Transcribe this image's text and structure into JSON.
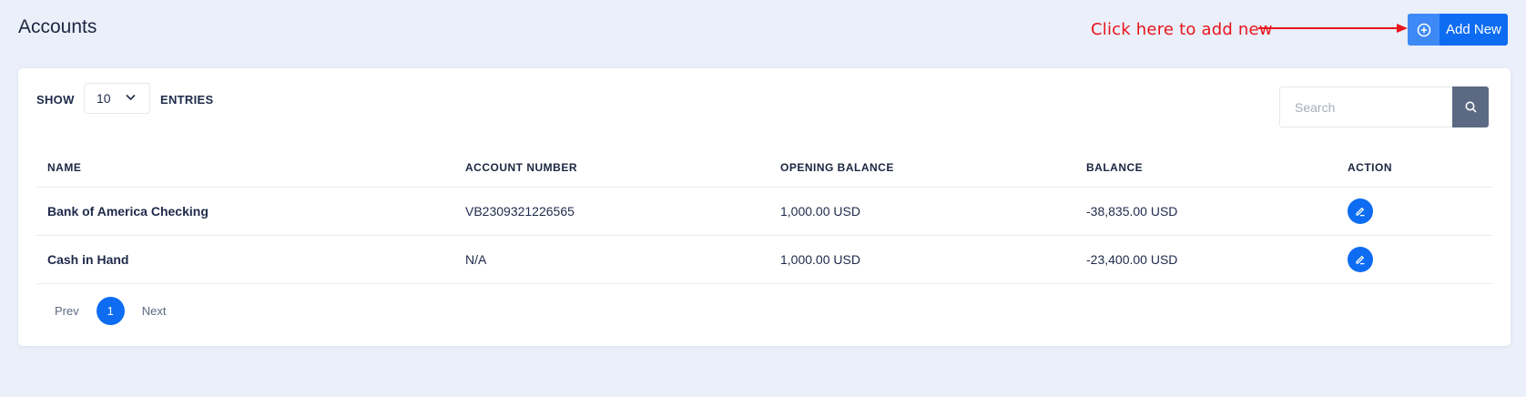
{
  "page": {
    "title": "Accounts"
  },
  "annotation": {
    "text": "Click here to add new",
    "color": "#e8141c"
  },
  "header": {
    "add_label": "Add New",
    "add_icon": "plus-circle-icon"
  },
  "controls": {
    "show_label": "SHOW",
    "entries_value": "10",
    "entries_label": "ENTRIES",
    "search_placeholder": "Search",
    "search_icon": "search-icon"
  },
  "table": {
    "columns": [
      "NAME",
      "ACCOUNT NUMBER",
      "OPENING BALANCE",
      "BALANCE",
      "ACTION"
    ],
    "rows": [
      {
        "name": "Bank of America Checking",
        "account_number": "VB2309321226565",
        "opening_balance": "1,000.00 USD",
        "balance": "-38,835.00 USD",
        "action_icon": "edit-icon"
      },
      {
        "name": "Cash in Hand",
        "account_number": "N/A",
        "opening_balance": "1,000.00 USD",
        "balance": "-23,400.00 USD",
        "action_icon": "edit-icon"
      }
    ]
  },
  "pagination": {
    "prev_label": "Prev",
    "current_page": "1",
    "next_label": "Next"
  },
  "colors": {
    "primary": "#0d6cf2",
    "background": "#eaeff9",
    "search_button": "#5b6983"
  }
}
